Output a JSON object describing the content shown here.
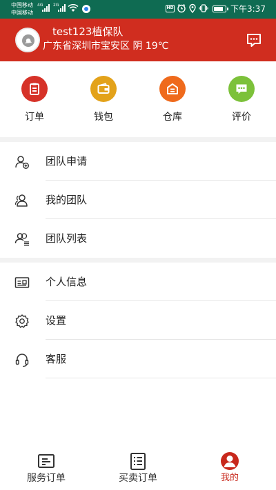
{
  "status_bar": {
    "carrier_1": "中国移动",
    "carrier_2": "中国移动",
    "net_1": "4G",
    "net_2": "2G",
    "hd": "HD",
    "time": "下午3:37",
    "battery_level": 0.8
  },
  "header": {
    "team_name": "test123植保队",
    "location": "广东省深圳市宝安区 阴 19℃",
    "colors": {
      "background": "#d02d1f"
    }
  },
  "quick_actions": [
    {
      "label": "订单",
      "icon": "order-icon",
      "color": "#d63228"
    },
    {
      "label": "钱包",
      "icon": "wallet-icon",
      "color": "#e3a21a"
    },
    {
      "label": "仓库",
      "icon": "warehouse-icon",
      "color": "#ef6a1c"
    },
    {
      "label": "评价",
      "icon": "review-icon",
      "color": "#7cc13a"
    }
  ],
  "menu": {
    "team": [
      {
        "label": "团队申请",
        "icon": "user-add-icon"
      },
      {
        "label": "我的团队",
        "icon": "users-icon"
      },
      {
        "label": "团队列表",
        "icon": "team-list-icon"
      }
    ],
    "personal": [
      {
        "label": "个人信息",
        "icon": "id-card-icon"
      },
      {
        "label": "设置",
        "icon": "gear-icon"
      },
      {
        "label": "客服",
        "icon": "headset-icon"
      }
    ]
  },
  "bottom_nav": [
    {
      "label": "服务订单",
      "icon": "service-order-icon"
    },
    {
      "label": "买卖订单",
      "icon": "trade-order-icon"
    },
    {
      "label": "我的",
      "icon": "profile-icon",
      "active": true
    }
  ]
}
